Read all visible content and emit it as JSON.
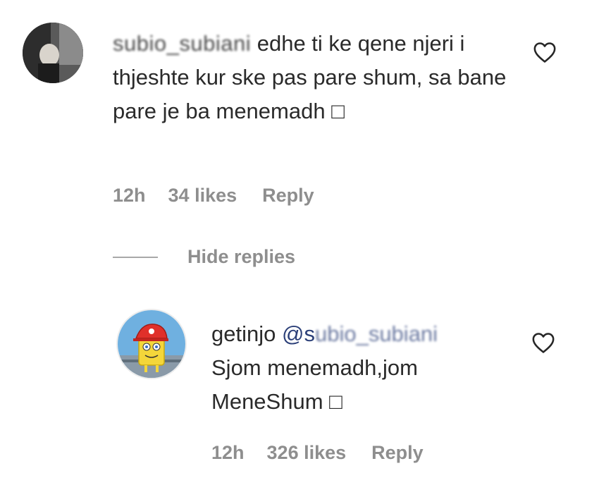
{
  "parent_comment": {
    "username": "subio_subiani",
    "text": "edhe ti ke qene njeri i thjeshte kur ske pas pare shum, sa bane pare je ba menemadh □",
    "time": "12h",
    "likes": "34 likes",
    "reply_label": "Reply",
    "like_icon": "heart-outline-icon"
  },
  "hide_replies_label": "Hide replies",
  "reply_comment": {
    "username": "getinjo",
    "mention_prefix": "@s",
    "mention_rest": "ubio_subiani",
    "text": "Sjom menemadh,jom MeneShum □",
    "time": "12h",
    "likes": "326 likes",
    "reply_label": "Reply",
    "like_icon": "heart-outline-icon"
  },
  "colors": {
    "text": "#262626",
    "meta": "#8e8e8e",
    "mention": "#2b3f78",
    "background": "#ffffff"
  }
}
